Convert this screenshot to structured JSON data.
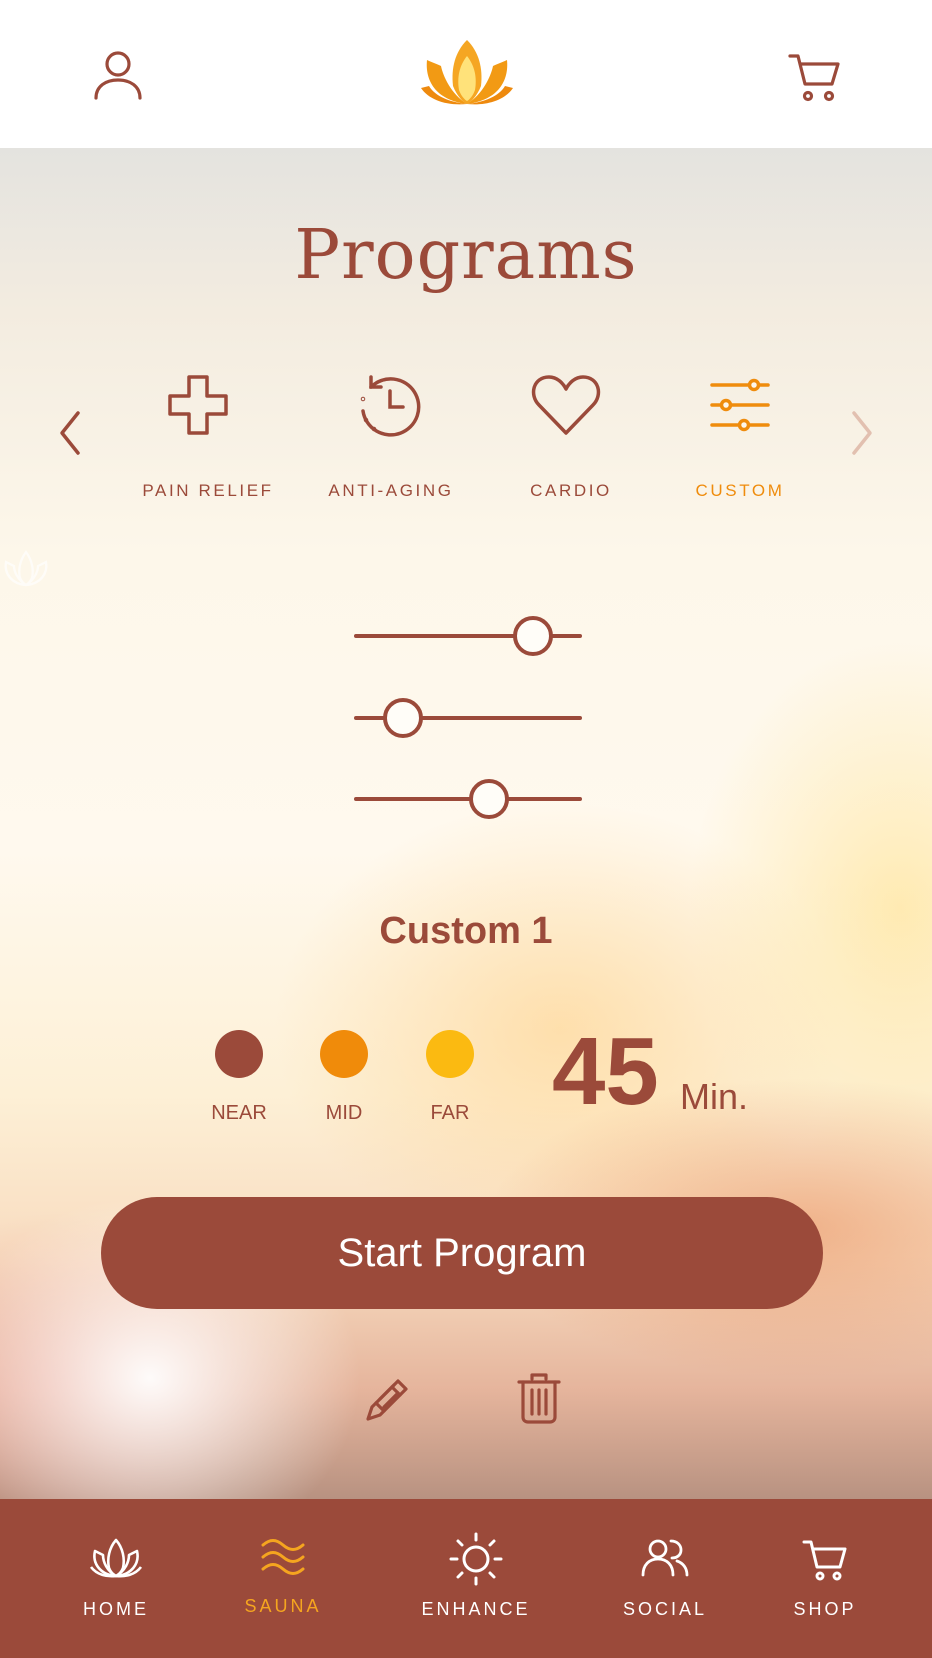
{
  "header": {
    "profile_icon": "user-icon",
    "logo_icon": "lotus-logo",
    "cart_icon": "cart-icon"
  },
  "page": {
    "title": "Programs"
  },
  "programs": {
    "prev_icon": "chevron-left-icon",
    "next_icon": "chevron-right-icon",
    "items": [
      {
        "label": "PAIN RELIEF",
        "icon": "plus-cross-icon",
        "active": false
      },
      {
        "label": "ANTI-AGING",
        "icon": "history-clock-icon",
        "active": false
      },
      {
        "label": "CARDIO",
        "icon": "heart-icon",
        "active": false
      },
      {
        "label": "CUSTOM",
        "icon": "sliders-icon",
        "active": true
      }
    ]
  },
  "custom": {
    "sliders": [
      {
        "level": 0.78
      },
      {
        "level": 0.22
      },
      {
        "level": 0.59
      }
    ],
    "name": "Custom 1",
    "heat_zones": [
      {
        "label": "NEAR",
        "color": "#9b4a3a"
      },
      {
        "label": "MID",
        "color": "#f08b0a"
      },
      {
        "label": "FAR",
        "color": "#fbba11"
      }
    ],
    "duration": {
      "value": "45",
      "unit": "Min."
    }
  },
  "actions": {
    "start_label": "Start Program",
    "edit_icon": "pencil-icon",
    "delete_icon": "trash-icon"
  },
  "nav": {
    "items": [
      {
        "label": "HOME",
        "icon": "lotus-icon",
        "active": false
      },
      {
        "label": "SAUNA",
        "icon": "waves-icon",
        "active": true
      },
      {
        "label": "ENHANCE",
        "icon": "sun-icon",
        "active": false
      },
      {
        "label": "SOCIAL",
        "icon": "users-icon",
        "active": false
      },
      {
        "label": "SHOP",
        "icon": "cart-icon",
        "active": false
      }
    ]
  },
  "colors": {
    "brand": "#9b4a3a",
    "accent": "#ef8c0d",
    "nav_active": "#f5a51f"
  }
}
